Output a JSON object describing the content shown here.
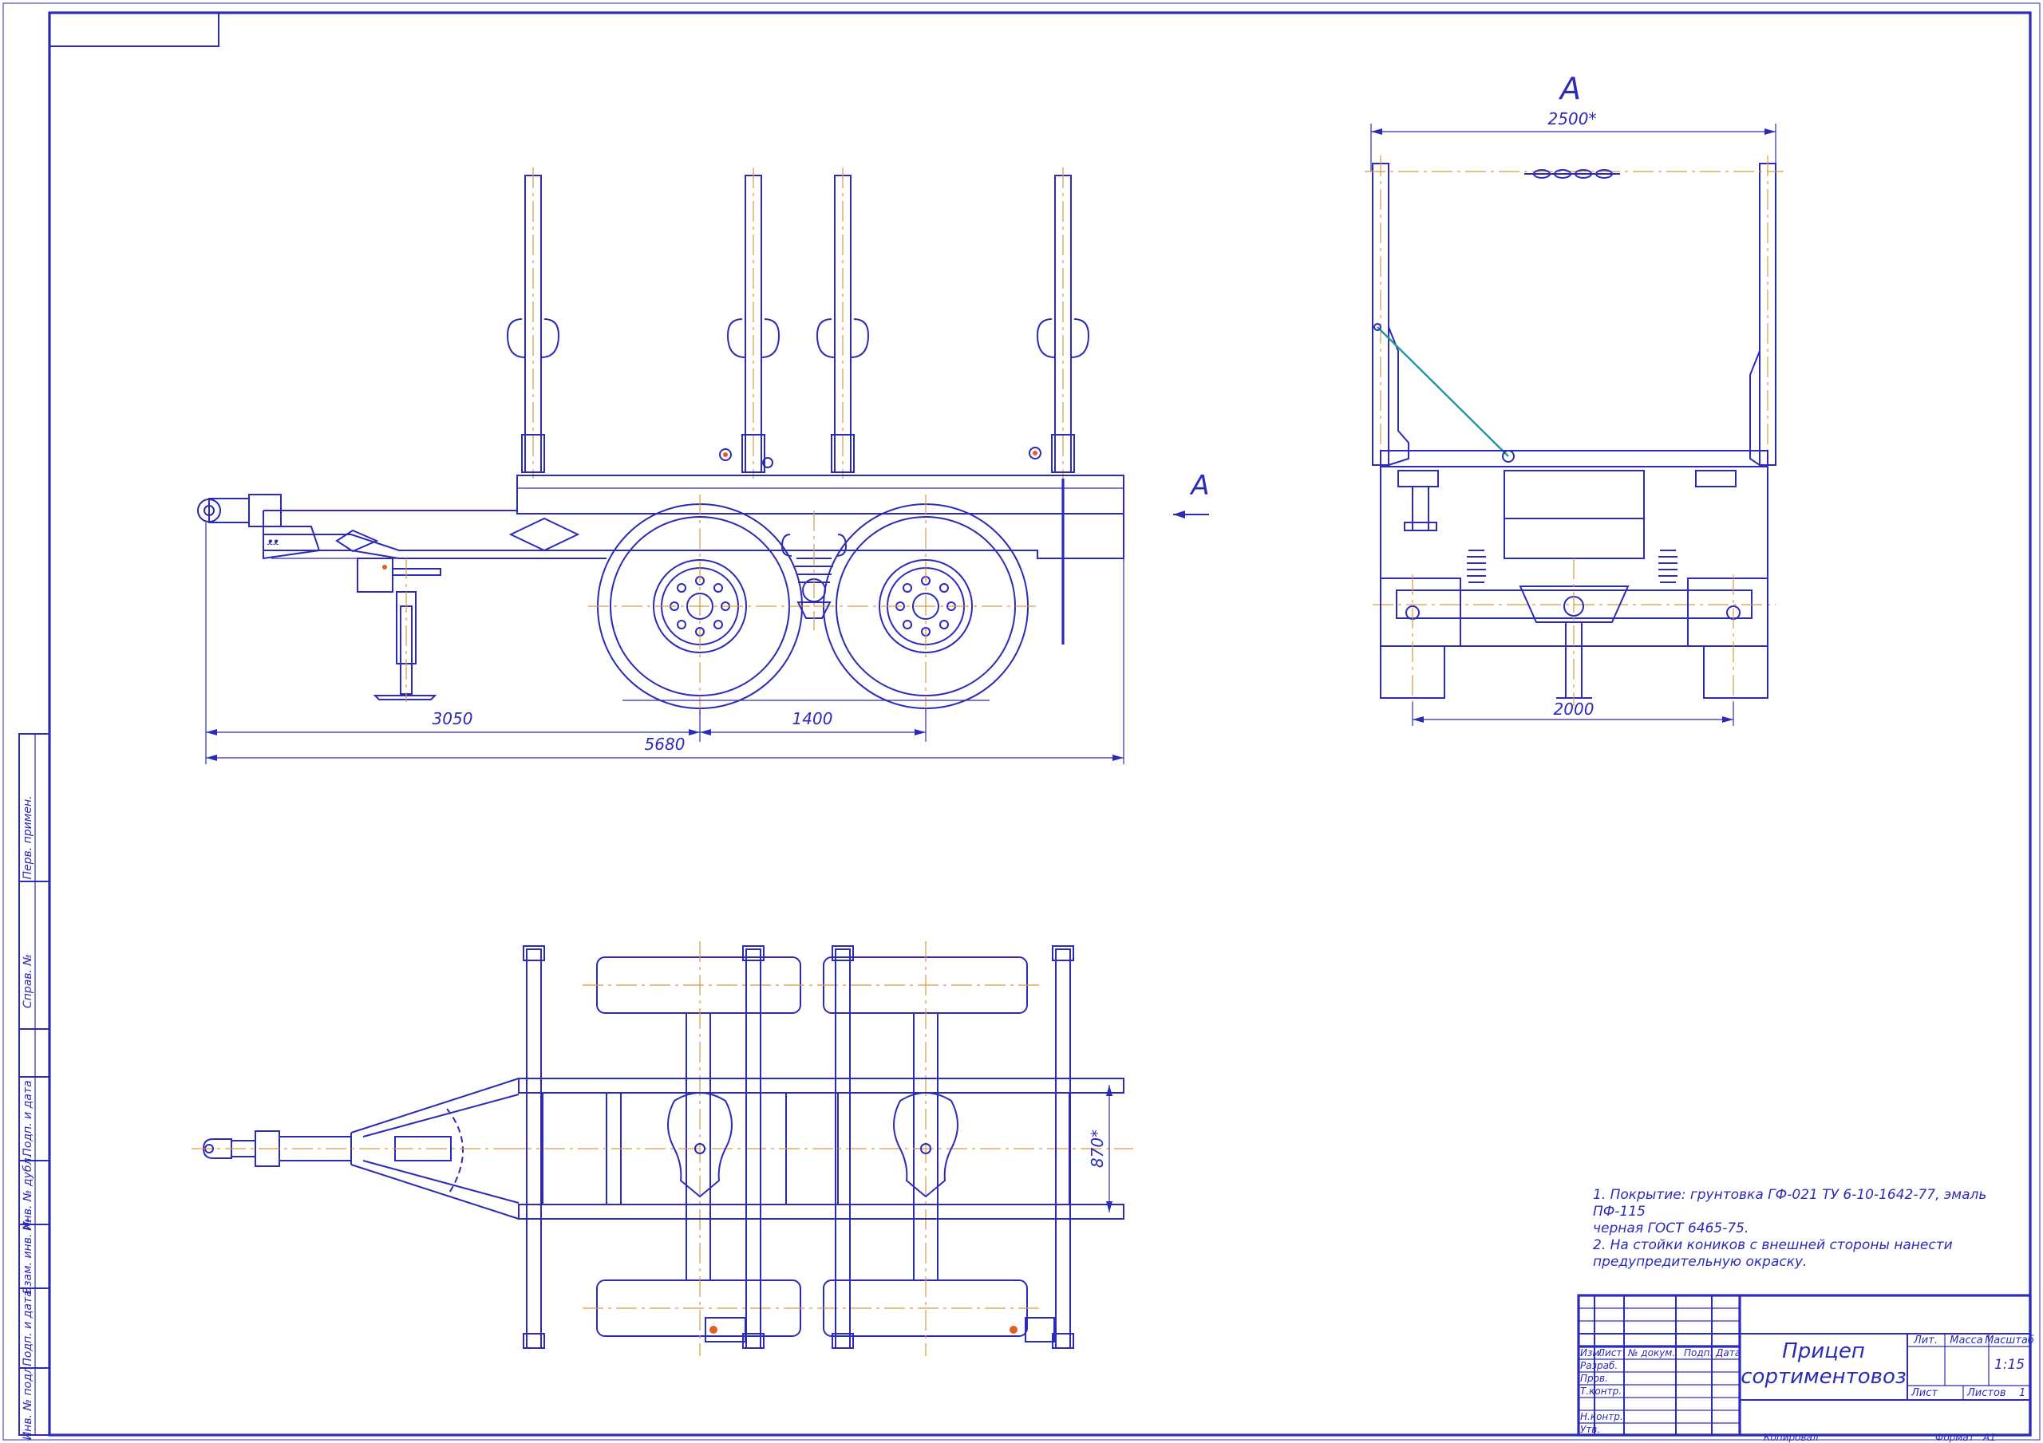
{
  "view_label": "A",
  "section_arrow_label": "A",
  "dimensions": {
    "width_top": "2500*",
    "track": "2000",
    "hitch_to_axle": "3050",
    "axle_base": "1400",
    "overall_length": "5680",
    "frame_width": "870*"
  },
  "notes": [
    "1. Покрытие: грунтовка ГФ-021 ТУ 6-10-1642-77, эмаль ПФ-115",
    "черная ГОСТ 6465-75.",
    "2. На стойки коников с внешней стороны нанести",
    "предупредительную окраску."
  ],
  "title_block": {
    "name_line1": "Прицеп",
    "name_line2": "сортиментовоз",
    "col_izm": "Изм.",
    "col_list": "Лист",
    "col_doc": "№ докум.",
    "col_sign": "Подп.",
    "col_date": "Дата",
    "row_razrab": "Разраб.",
    "row_prov": "Пров.",
    "row_tkontr": "Т.контр.",
    "row_nkontr": "Н.контр.",
    "row_utv": "Утв.",
    "lit": "Лит.",
    "mass": "Масса",
    "scale_label": "Масштаб",
    "scale_value": "1:15",
    "sheet": "Лист",
    "sheets": "Листов",
    "sheets_value": "1",
    "copied": "Копировал",
    "format": "Формат",
    "format_value": "А1"
  },
  "side_stamp": {
    "perv_primen": "Перв. примен.",
    "sprav": "Справ. №",
    "podp_data1": "Подп. и дата",
    "inv_dubl": "Инв. № дубл.",
    "vzam_inv": "Взам. инв. №",
    "podp_data2": "Подп. и дата",
    "inv_podl": "Инв. № подл."
  },
  "colors": {
    "line": "#2b2bb8",
    "center_line": "#d99a3c",
    "cable": "#1a9a9a"
  }
}
